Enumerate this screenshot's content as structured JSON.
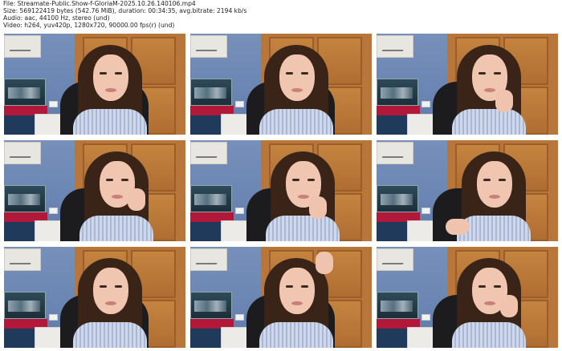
{
  "header": {
    "file": "File: Streamate-Public.Show-f-GloriaM-2025.10.26.140106.mp4",
    "size": "Size: 569122419 bytes (542.76 MiB), duration: 00:34:35, avg.bitrate: 2194 kb/s",
    "audio": "Audio: aac, 44100 Hz, stereo (und)",
    "video": "Video: h264, yuv420p, 1280x720, 90000.00 fps(r) (und)"
  },
  "thumbnails": [
    {
      "pose": "neutral"
    },
    {
      "pose": "neutral"
    },
    {
      "pose": "hand-chin"
    },
    {
      "pose": "hand-cheek"
    },
    {
      "pose": "hand-chin"
    },
    {
      "pose": "lean-hand"
    },
    {
      "pose": "neutral"
    },
    {
      "pose": "hand-head"
    },
    {
      "pose": "hand-cheek"
    }
  ]
}
